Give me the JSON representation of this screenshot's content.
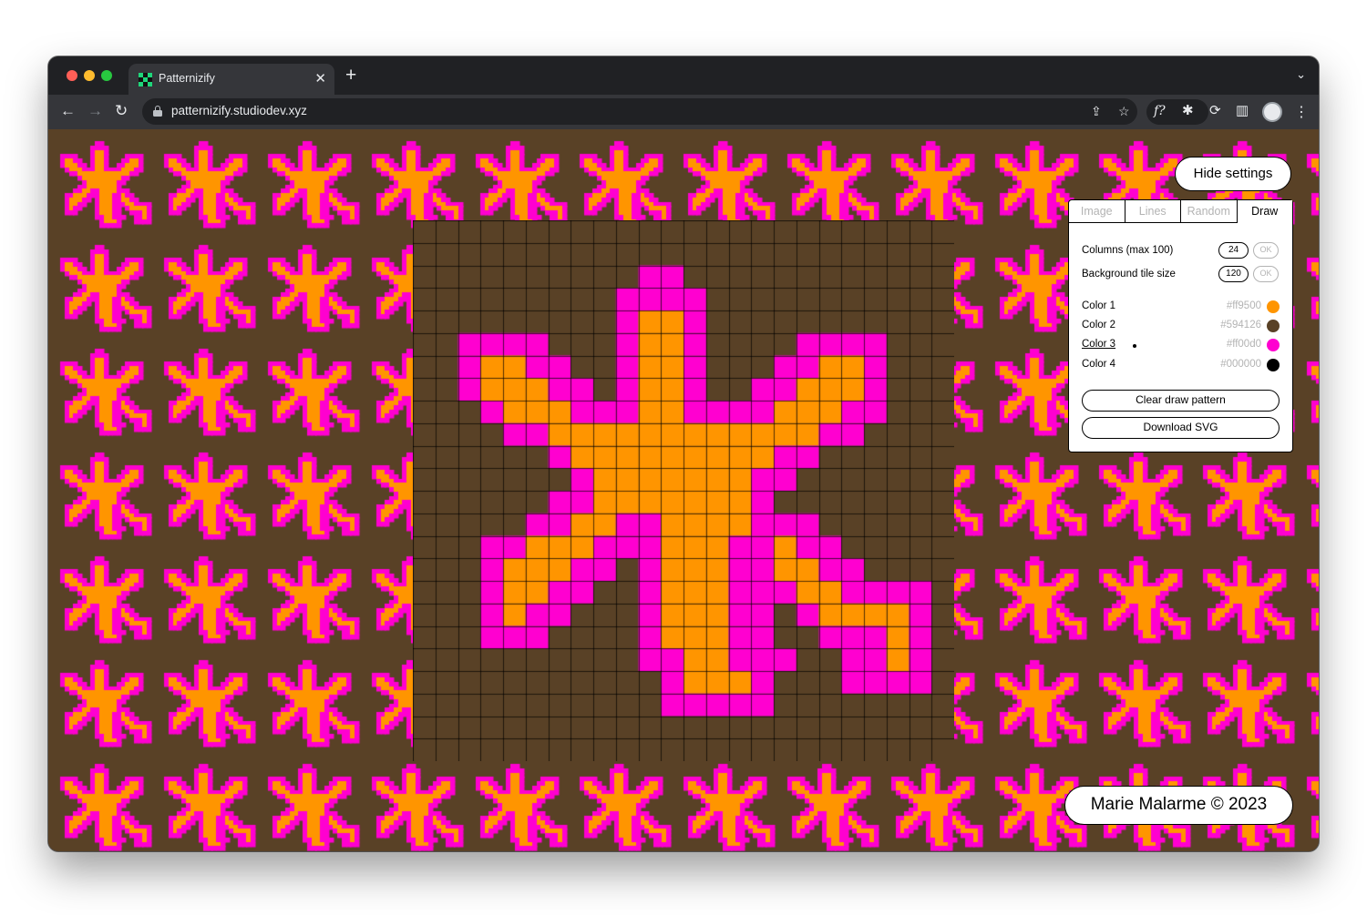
{
  "browser": {
    "tab_title": "Patternizify",
    "tab_close_glyph": "✕",
    "new_tab_glyph": "+",
    "tab_menu_glyph": "⌄",
    "url": "patternizify.studiodev.xyz",
    "back_glyph": "←",
    "forward_glyph": "→",
    "reload_glyph": "↻",
    "share_glyph": "⇪",
    "bookmark_glyph": "☆",
    "ext_fonts_glyph": "f?",
    "ext_puzzle_glyph": "✱",
    "ext_refresh_glyph": "⟳",
    "sidebar_glyph": "▥",
    "menu_glyph": "⋮"
  },
  "app": {
    "hide_settings_label": "Hide settings",
    "tabs": [
      {
        "label": "Image",
        "active": false
      },
      {
        "label": "Lines",
        "active": false
      },
      {
        "label": "Random",
        "active": false
      },
      {
        "label": "Draw",
        "active": true
      }
    ],
    "columns": {
      "label": "Columns (max 100)",
      "value": "24",
      "ok": "OK"
    },
    "tile_size": {
      "label": "Background tile size",
      "value": "120",
      "ok": "OK"
    },
    "colors": [
      {
        "label": "Color 1",
        "hex": "#ff9500",
        "selected": false
      },
      {
        "label": "Color 2",
        "hex": "#594126",
        "selected": false
      },
      {
        "label": "Color 3",
        "hex": "#ff00d0",
        "selected": true
      },
      {
        "label": "Color 4",
        "hex": "#000000",
        "selected": false
      }
    ],
    "clear_label": "Clear draw pattern",
    "download_label": "Download SVG",
    "credit": "Marie Malarme © 2023"
  },
  "palette": {
    "orange": "#ff9500",
    "brown": "#594126",
    "magenta": "#ff00d0",
    "black": "#000000"
  },
  "pattern": {
    "columns": 24,
    "rows": [
      "........................",
      "........................",
      "..........MM............",
      ".........MMMM...........",
      ".........MOOM...........",
      "..MMMM...MOOM....MMMM...",
      "..MOOMM..MOOM...MMOOM...",
      "..MOOOMM.MOOM..MMOOOM...",
      "...MOOOMMMOOMMMMOOOMM...",
      "....MMOOOOOOOOOOOOMM....",
      "......MOOOOOOOOOMM......",
      ".......MOOOOOOOMM.......",
      "......MMOOOOOOOM........",
      ".....MMOOMMOOOOMMM......",
      "...MMOOOMMMOOOMMOMM.....",
      "...MOOOMM.MOOOMMOOMM....",
      "...MOOMM..MOOOMMMOOMMMM.",
      "...MOMM...MOOOMM.MOOOOM.",
      "...MMM....MOOOMM..MMMOM.",
      "..........MMOOMMM..MMOM.",
      "...........MOOOM...MMMM.",
      "...........MMMMM........",
      "........................",
      "........................"
    ]
  }
}
